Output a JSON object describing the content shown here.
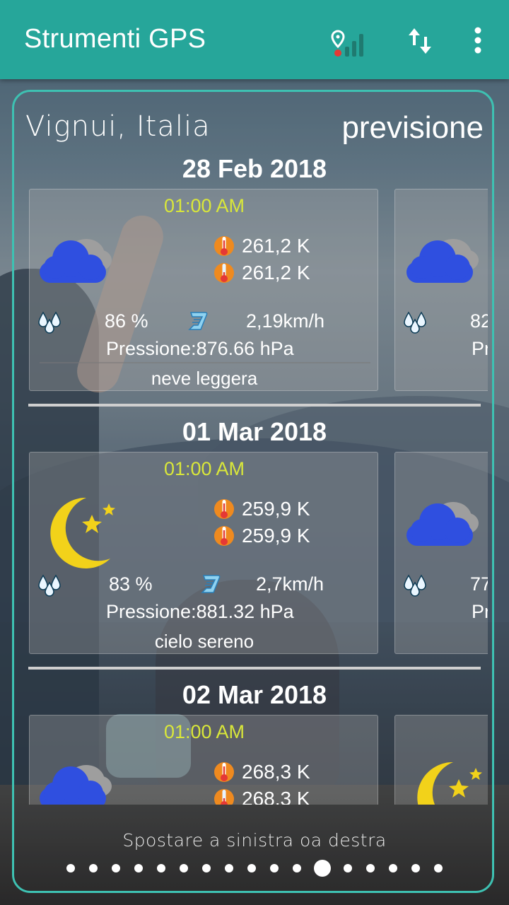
{
  "appbar": {
    "title": "Strumenti GPS",
    "color": "#26a69a"
  },
  "header": {
    "city": "Vignui, Italia",
    "mode": "previsione"
  },
  "days": [
    {
      "date": "28 Feb 2018",
      "card": {
        "time": "01:00 AM",
        "icon": "cloud-icon",
        "temp_max": "261,2 K",
        "temp_min": "261,2 K",
        "humidity": "86 %",
        "wind": "2,19km/h",
        "pressure": "Pressione:876.66 hPa",
        "description": "neve leggera"
      },
      "next_card": {
        "icon": "cloud-icon",
        "humidity": "82",
        "pressure": "Pr"
      }
    },
    {
      "date": "01 Mar 2018",
      "card": {
        "time": "01:00 AM",
        "icon": "moon-icon",
        "temp_max": "259,9 K",
        "temp_min": "259,9 K",
        "humidity": "83 %",
        "wind": "2,7km/h",
        "pressure": "Pressione:881.32 hPa",
        "description": "cielo sereno"
      },
      "next_card": {
        "icon": "cloud-icon",
        "humidity": "77",
        "pressure": "Pr"
      }
    },
    {
      "date": "02 Mar 2018",
      "card": {
        "time": "01:00 AM",
        "icon": "cloud-icon",
        "temp_max": "268,3 K",
        "temp_min": "268,3 K"
      },
      "next_card": {
        "icon": "moon-icon"
      }
    }
  ],
  "footer": {
    "hint": "Spostare a sinistra oa destra",
    "page_count": 17,
    "active_page": 12
  },
  "colors": {
    "accent": "#3ec1b2",
    "time_text": "#d9e73a",
    "cloud": "#2f4fe0",
    "moon": "#f2d21a"
  }
}
